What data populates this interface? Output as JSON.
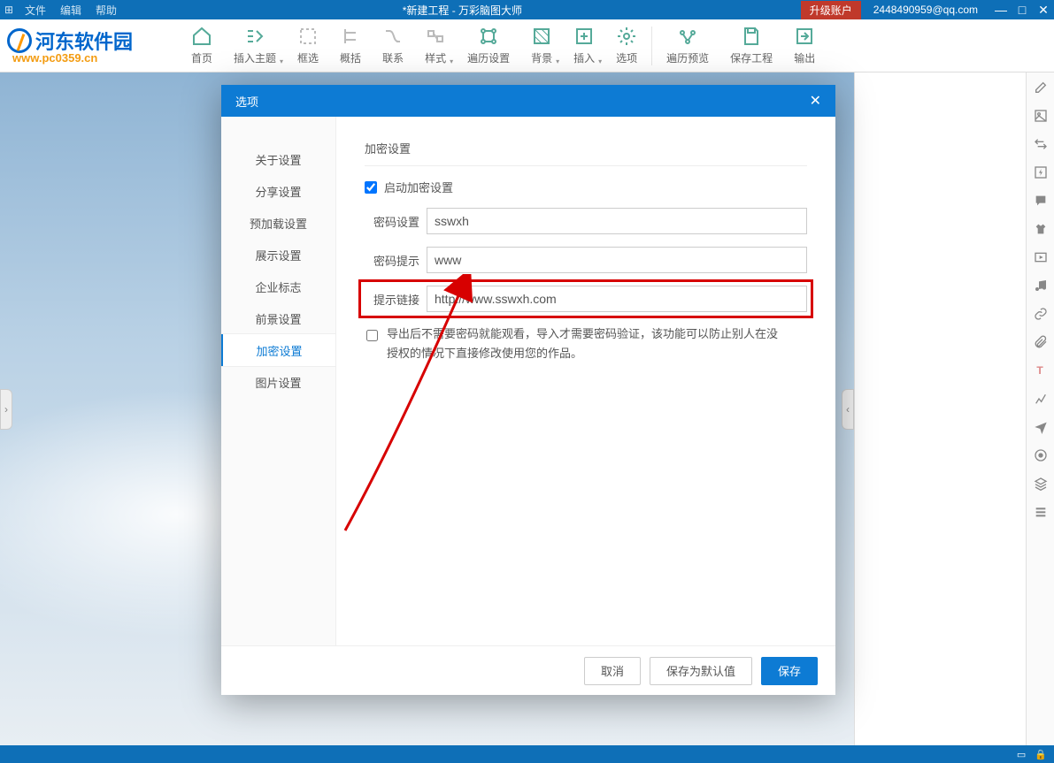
{
  "titlebar": {
    "menus": [
      "文件",
      "编辑",
      "帮助"
    ],
    "title": "*新建工程 - 万彩脑图大师",
    "upgrade": "升级账户",
    "account": "2448490959@qq.com"
  },
  "logo": {
    "line1": "河东软件园",
    "line2": "www.pc0359.cn"
  },
  "toolbar": [
    {
      "id": "home",
      "label": "首页"
    },
    {
      "id": "insert-topic",
      "label": "插入主题",
      "caret": true
    },
    {
      "id": "frame",
      "label": "框选"
    },
    {
      "id": "summary",
      "label": "概括"
    },
    {
      "id": "relation",
      "label": "联系"
    },
    {
      "id": "style",
      "label": "样式",
      "caret": true
    },
    {
      "id": "traverse-settings",
      "label": "遍历设置"
    },
    {
      "id": "background",
      "label": "背景",
      "caret": true
    },
    {
      "id": "insert",
      "label": "插入",
      "caret": true
    },
    {
      "id": "options",
      "label": "选项"
    },
    {
      "id": "traverse-preview",
      "label": "遍历预览"
    },
    {
      "id": "save-project",
      "label": "保存工程"
    },
    {
      "id": "export",
      "label": "输出"
    }
  ],
  "right_icons": [
    "edit",
    "image",
    "swap",
    "flash",
    "comment",
    "shirt",
    "video",
    "music",
    "link",
    "attach",
    "text",
    "chart",
    "plane",
    "record",
    "layers",
    "list"
  ],
  "modal": {
    "title": "选项",
    "nav": [
      "关于设置",
      "分享设置",
      "预加载设置",
      "展示设置",
      "企业标志",
      "前景设置",
      "加密设置",
      "图片设置"
    ],
    "nav_active": 6,
    "section_title": "加密设置",
    "enable_label": "启动加密设置",
    "enable_checked": true,
    "fields": {
      "password": {
        "label": "密码设置",
        "value": "sswxh"
      },
      "hint": {
        "label": "密码提示",
        "value": "www"
      },
      "link": {
        "label": "提示链接",
        "value": "http://www.sswxh.com"
      }
    },
    "export_note_checked": false,
    "export_note": "导出后不需要密码就能观看，导入才需要密码验证，该功能可以防止别人在没授权的情况下直接修改使用您的作品。",
    "buttons": {
      "cancel": "取消",
      "save_default": "保存为默认值",
      "save": "保存"
    }
  }
}
